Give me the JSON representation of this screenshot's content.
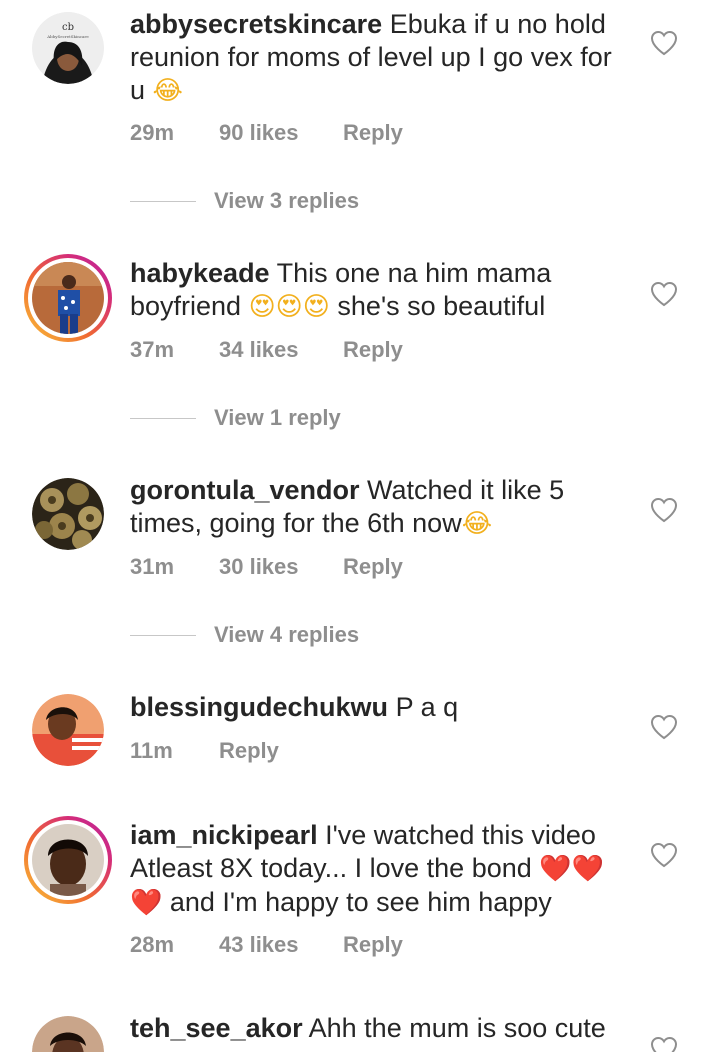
{
  "comments": [
    {
      "username": "abbysecretskincare",
      "text_parts": [
        "Ebuka if u no hold reunion for moms of level up I go vex for u "
      ],
      "emoji": "😂",
      "time": "29m",
      "likes": "90 likes",
      "reply": "Reply",
      "view_replies": "View 3 replies"
    },
    {
      "username": "habykeade",
      "text_before": "This one na him mama boyfriend ",
      "emoji": "😍😍😍",
      "text_after": " she's so beautiful",
      "time": "37m",
      "likes": "34 likes",
      "reply": "Reply",
      "view_replies": "View 1 reply"
    },
    {
      "username": "gorontula_vendor",
      "text": "Watched it like 5 times, going for the 6th now",
      "emoji": "😂",
      "time": "31m",
      "likes": "30 likes",
      "reply": "Reply",
      "view_replies": "View 4 replies"
    },
    {
      "username": "blessingudechukwu",
      "text": "P a q",
      "time": "11m",
      "reply": "Reply"
    },
    {
      "username": "iam_nickipearl",
      "text_before": "I've watched this video Atleast 8X today... I love the bond ",
      "emoji": "❤️❤️",
      "emoji2": "❤️",
      "text_after": " and I'm happy to see him happy",
      "time": "28m",
      "likes": "43 likes",
      "reply": "Reply"
    },
    {
      "username": "teh_see_akor",
      "text": "Ahh the mum is soo cute"
    }
  ],
  "icons": {
    "like": "heart-outline-icon"
  },
  "colors": {
    "text": "#262626",
    "muted": "#8e8e8e",
    "story_ring": "#d42c7a"
  }
}
